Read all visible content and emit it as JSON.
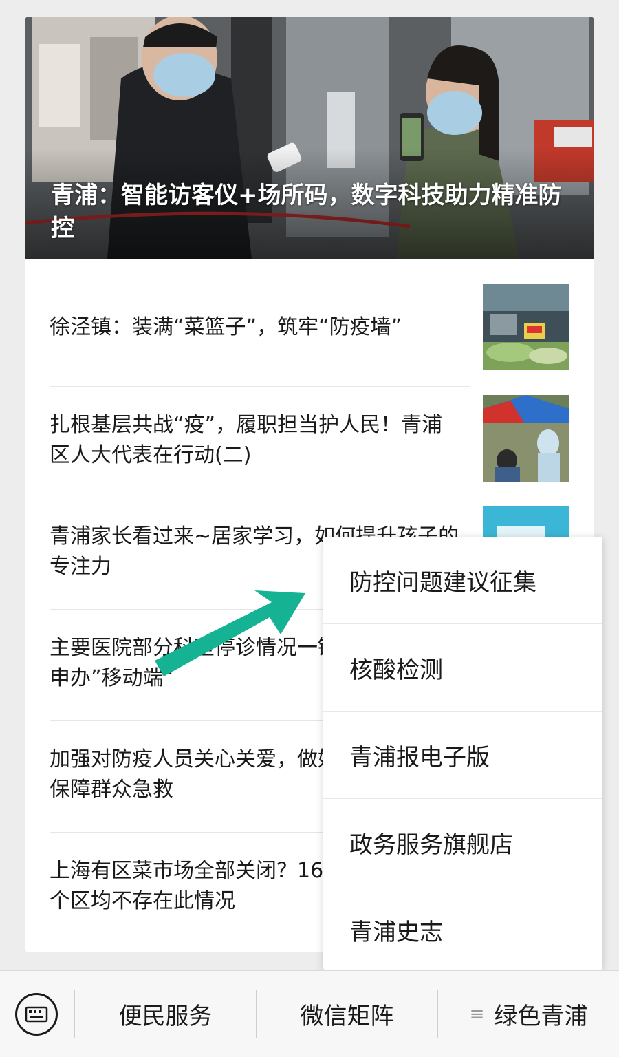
{
  "hero": {
    "title": "青浦：智能访客仪+场所码，数字科技助力精准防控"
  },
  "articles": [
    {
      "title": "徐泾镇：装满“菜篮子”，筑牢“防疫墙”"
    },
    {
      "title": "扎根基层共战“疫”，履职担当护人民！青浦区人大代表在行动(二)"
    },
    {
      "title": "青浦家长看过来~居家学习，如何提升孩子的专注力"
    },
    {
      "title": "主要医院部分科室停诊情况一键助查……“随申办”移动端“"
    },
    {
      "title": "加强对防疫人员关心关爱，做好告知和引导，保障群众急救"
    },
    {
      "title": "上海有区菜市场全部关闭？16个区均不存在此情况"
    }
  ],
  "popup_menu": {
    "items": [
      "防控问题建议征集",
      "核酸检测",
      "青浦报电子版",
      "政务服务旗舰店",
      "青浦史志"
    ]
  },
  "bottom_bar": {
    "keyboard_icon": "keyboard-icon",
    "tabs": [
      "便民服务",
      "微信矩阵",
      "绿色青浦"
    ],
    "menu_glyph": "≡"
  },
  "colors": {
    "arrow": "#15b394",
    "background": "#ededed"
  }
}
